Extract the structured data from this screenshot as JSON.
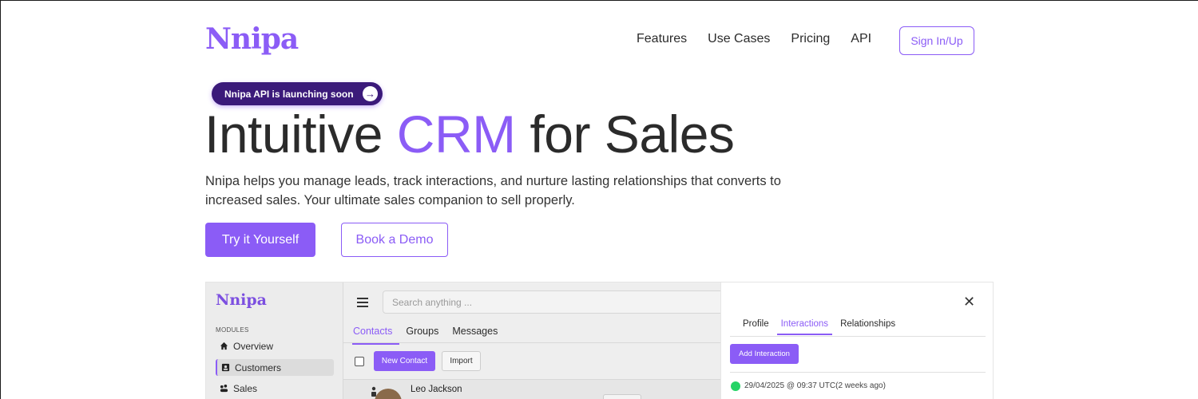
{
  "brand": {
    "name": "Nnipa",
    "accent_color": "#8b5cf6"
  },
  "nav": {
    "items": [
      "Features",
      "Use Cases",
      "Pricing",
      "API"
    ],
    "signin_label": "Sign In/Up"
  },
  "hero": {
    "announcement": "Nnipa API is launching soon",
    "announcement_icon": "arrow-right-icon",
    "title_before": "Intuitive ",
    "title_accent": "CRM",
    "title_after": " for Sales",
    "subtitle": "Nnipa helps you manage leads, track interactions, and nurture lasting relationships that converts to increased sales. Your ultimate sales companion to sell properly.",
    "primary_cta": "Try it Yourself",
    "secondary_cta": "Book a Demo"
  },
  "preview": {
    "logo": "Nnipa",
    "modules_label": "MODULES",
    "sidebar_items": [
      {
        "label": "Overview",
        "icon": "home-icon",
        "active": false
      },
      {
        "label": "Customers",
        "icon": "contacts-icon",
        "active": true
      },
      {
        "label": "Sales",
        "icon": "sales-icon",
        "active": false
      }
    ],
    "search_placeholder": "Search anything ...",
    "tabs": [
      "Contacts",
      "Groups",
      "Messages"
    ],
    "active_tab": "Contacts",
    "new_contact_label": "New Contact",
    "import_label": "Import",
    "rows": [
      {
        "name": "Leo Jackson"
      }
    ],
    "panel": {
      "tabs": [
        "Profile",
        "Interactions",
        "Relationships"
      ],
      "active_tab": "Interactions",
      "add_button": "Add Interaction",
      "interaction_timestamp": "29/04/2025 @ 09:37 UTC(2 weeks ago)",
      "interaction_channel_icon": "whatsapp-icon"
    }
  }
}
